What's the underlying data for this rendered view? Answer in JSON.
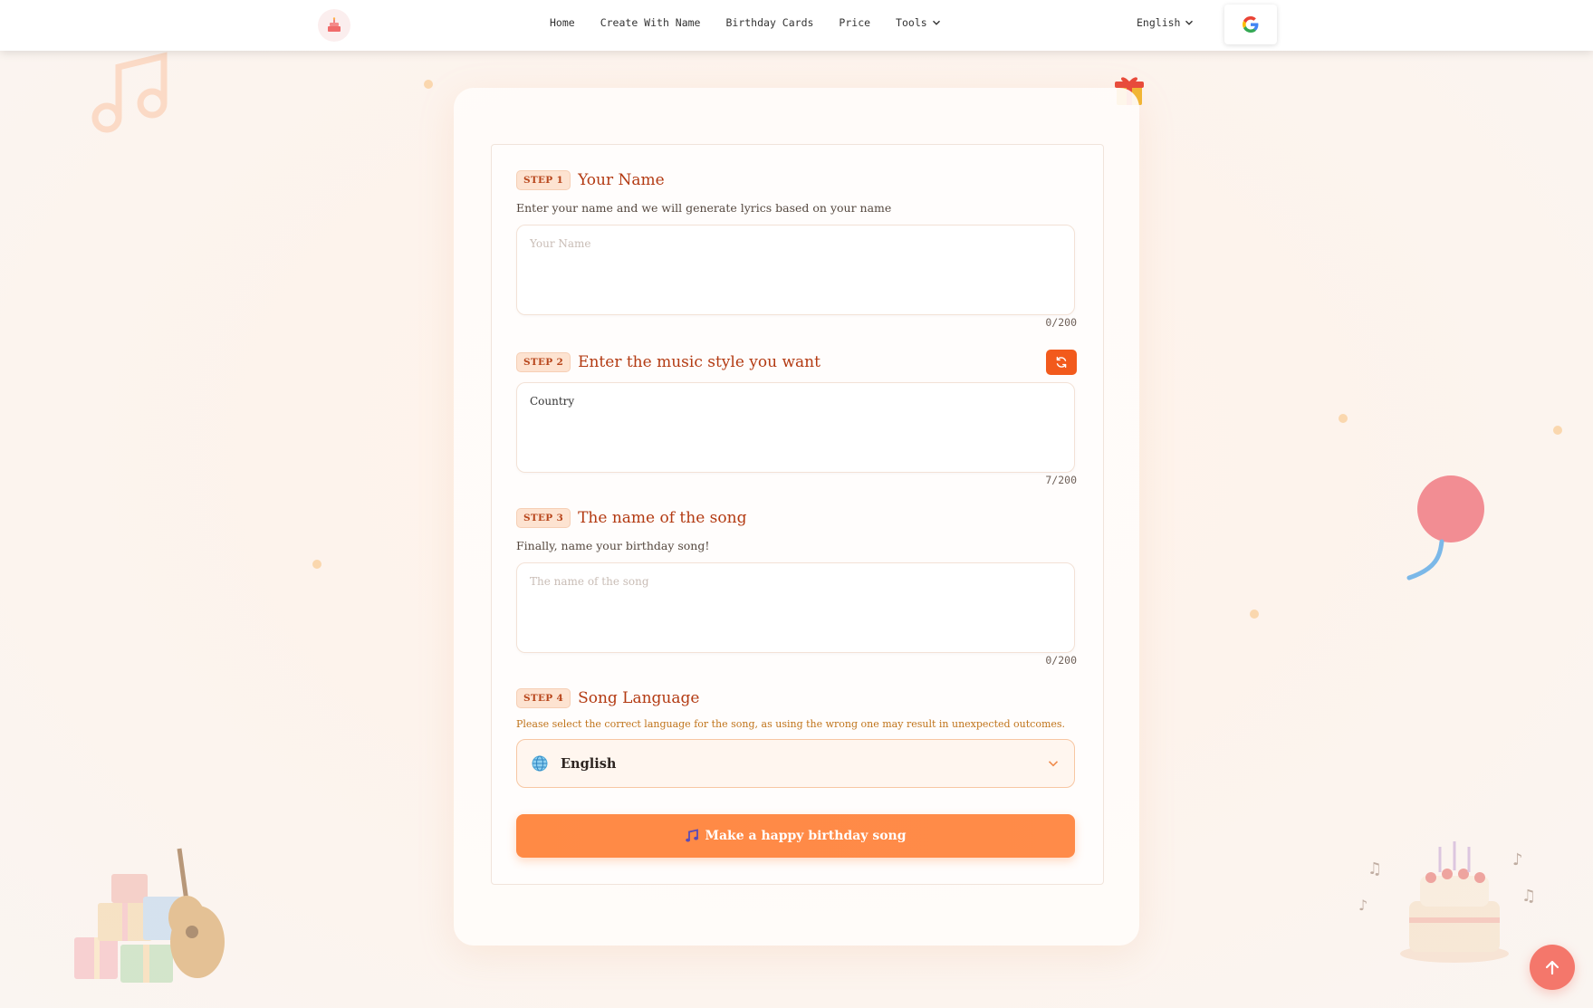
{
  "nav": {
    "items": [
      "Home",
      "Create With Name",
      "Birthday Cards",
      "Price"
    ],
    "tools_label": "Tools",
    "language": "English"
  },
  "steps": [
    {
      "badge": "STEP 1",
      "title": "Your Name",
      "description": "Enter your name and we will generate lyrics based on your name",
      "placeholder": "Your Name",
      "value": "",
      "counter": "0/200"
    },
    {
      "badge": "STEP 2",
      "title": "Enter the music style you want",
      "value": "Country",
      "counter": "7/200"
    },
    {
      "badge": "STEP 3",
      "title": "The name of the song",
      "description": "Finally, name your birthday song!",
      "placeholder": "The name of the song",
      "value": "",
      "counter": "0/200"
    },
    {
      "badge": "STEP 4",
      "title": "Song Language",
      "warning": "Please select the correct language for the song, as using the wrong one may result in unexpected outcomes.",
      "selected": "English"
    }
  ],
  "submit_label": "Make a happy birthday song",
  "colors": {
    "accent": "#ff8a45",
    "step_title": "#b33a12",
    "refresh_button": "#f25a1c",
    "back_to_top": "#f4776b"
  },
  "icons": [
    "cake-logo-icon",
    "chevron-down-icon",
    "google-icon",
    "refresh-icon",
    "globe-icon",
    "music-note-icon",
    "arrow-up-icon",
    "gift-icon",
    "balloon-icon"
  ]
}
